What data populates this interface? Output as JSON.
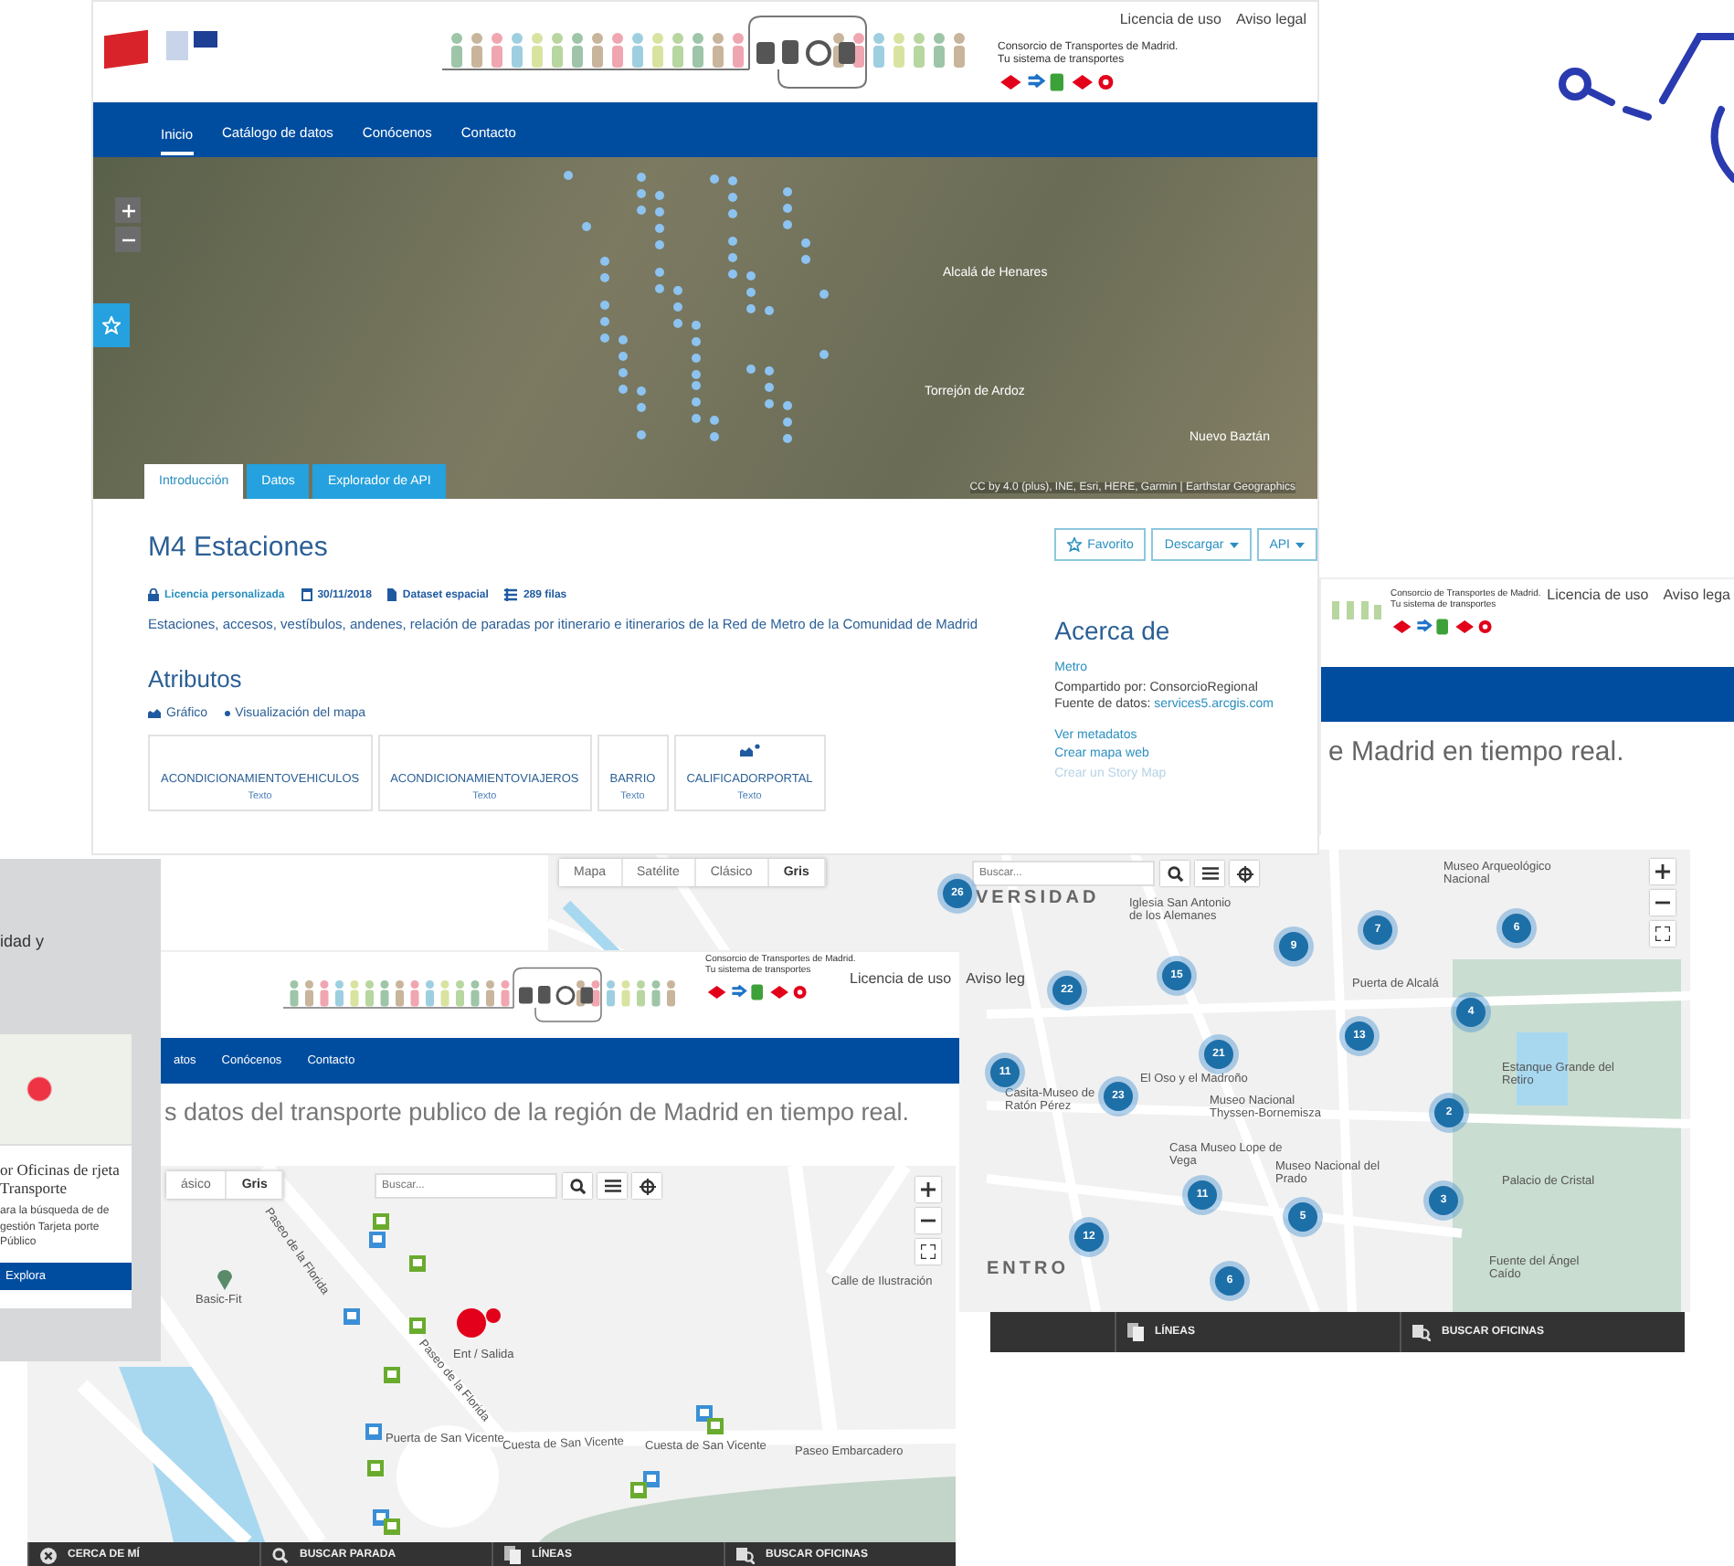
{
  "main_page": {
    "header_links": [
      "Licencia de uso",
      "Aviso legal"
    ],
    "consortium": [
      "Consorcio de Transportes de Madrid.",
      "Tu sistema de transportes"
    ],
    "nav": [
      {
        "label": "Inicio",
        "selected": true
      },
      {
        "label": "Catálogo de datos",
        "selected": false
      },
      {
        "label": "Conócenos",
        "selected": false
      },
      {
        "label": "Contacto",
        "selected": false
      }
    ],
    "map_labels": [
      "Alcalá de Henares",
      "Torrejón de Ardoz",
      "Nuevo Baztán"
    ],
    "attribution": "CC by 4.0 (plus), INE, Esri, HERE, Garmin | Earthstar Geographics",
    "tabs": [
      {
        "label": "Introducción",
        "selected": true
      },
      {
        "label": "Datos",
        "selected": false
      },
      {
        "label": "Explorador de API",
        "selected": false
      }
    ],
    "title": "M4 Estaciones",
    "actions": [
      {
        "kind": "favorite",
        "label": "Favorito"
      },
      {
        "kind": "menu",
        "label": "Descargar"
      },
      {
        "kind": "menu",
        "label": "API"
      }
    ],
    "meta": [
      {
        "kind": "license",
        "text": "Licencia personalizada"
      },
      {
        "kind": "date",
        "text": "30/11/2018"
      },
      {
        "kind": "dataset",
        "text": "Dataset espacial"
      },
      {
        "kind": "rows",
        "text": "289 filas"
      }
    ],
    "description": "Estaciones, accesos, vestíbulos, andenes, relación de paradas por itinerario e itinerarios de la Red de Metro de la Comunidad de Madrid",
    "attributes_heading": "Atributos",
    "views": [
      {
        "kind": "chart",
        "label": "Gráfico"
      },
      {
        "kind": "map",
        "label": "Visualización del mapa"
      }
    ],
    "attributes": [
      {
        "name": "ACONDICIONAMIENTOVEHICULOS",
        "type": "Texto",
        "chart": false
      },
      {
        "name": "ACONDICIONAMIENTOVIAJEROS",
        "type": "Texto",
        "chart": false
      },
      {
        "name": "BARRIO",
        "type": "Texto",
        "chart": false
      },
      {
        "name": "CALIFICADORPORTAL",
        "type": "Texto",
        "chart": true
      }
    ],
    "about": {
      "heading": "Acerca de",
      "category": "Metro",
      "shared": "Compartido por: ConsorcioRegional",
      "source_label": "Fuente de datos:",
      "source_link": "services5.arcgis.com",
      "links": [
        {
          "label": "Ver metadatos",
          "disabled": false
        },
        {
          "label": "Crear mapa web",
          "disabled": false
        },
        {
          "label": "Crear un Story Map",
          "disabled": true
        }
      ]
    }
  },
  "right_page": {
    "header_links": [
      "Licencia de uso",
      "Aviso lega"
    ],
    "consortium": [
      "Consorcio de Transportes de Madrid.",
      "Tu sistema de transportes"
    ],
    "tagline": "e Madrid en tiempo real."
  },
  "left_card": {
    "text": "idad y",
    "heading": "or Oficinas de rjeta Transporte",
    "description": "ara la búsqueda de de gestión Tarjeta porte Público",
    "button": "Explora"
  },
  "city_map": {
    "basemaps": [
      {
        "label": "Mapa",
        "selected": false
      },
      {
        "label": "Satélite",
        "selected": false
      },
      {
        "label": "Clásico",
        "selected": false
      },
      {
        "label": "Gris",
        "selected": true
      }
    ],
    "search_placeholder": "Buscar...",
    "clusters": [
      "26",
      "22",
      "15",
      "9",
      "7",
      "6",
      "4",
      "13",
      "21",
      "11",
      "23",
      "2",
      "11",
      "3",
      "5",
      "12",
      "6"
    ],
    "labels": [
      "VERSIDAD",
      "Museo Arqueológico Nacional",
      "Iglesia San Antonio de los Alemanes",
      "Puerta de Alcalá",
      "El Oso y el Madroño",
      "Casita-Museo de Ratón Pérez",
      "Museo Nacional Thyssen-Bornemisza",
      "Casa Museo Lope de Vega",
      "Museo Nacional del Prado",
      "Estanque Grande del Retiro",
      "Palacio de Cristal",
      "ENTRO",
      "Fuente del Ángel Caído"
    ],
    "bottom_bar": [
      {
        "kind": "lines",
        "label": "LÍNEAS"
      },
      {
        "kind": "offices",
        "label": "BUSCAR OFICINAS"
      }
    ]
  },
  "bottom_page": {
    "header_links": [
      "Licencia de uso",
      "Aviso leg"
    ],
    "consortium": [
      "Consorcio de Transportes de Madrid.",
      "Tu sistema de transportes"
    ],
    "nav": [
      {
        "label": "atos",
        "selected": false
      },
      {
        "label": "Conócenos",
        "selected": false
      },
      {
        "label": "Contacto",
        "selected": false
      }
    ],
    "tagline": "s datos del transporte publico de la región de Madrid en tiempo real.",
    "basemaps": [
      {
        "label": "ásico",
        "selected": false
      },
      {
        "label": "Gris",
        "selected": true
      }
    ],
    "search_placeholder": "Buscar...",
    "labels": [
      "Paseo de la Florida",
      "Paseo de la Florida",
      "Basic-Fit",
      "Calle de Ilustración",
      "Ent / Salida",
      "Puerta de San Vicente",
      "Cuesta de San Vicente",
      "Cuesta de San Vicente",
      "Paseo Embarcadero"
    ],
    "bottom_bar": [
      {
        "kind": "near",
        "label": "CERCA DE MÍ"
      },
      {
        "kind": "stop",
        "label": "BUSCAR PARADA"
      },
      {
        "kind": "lines",
        "label": "LÍNEAS"
      },
      {
        "kind": "offices",
        "label": "BUSCAR OFICINAS"
      }
    ]
  }
}
